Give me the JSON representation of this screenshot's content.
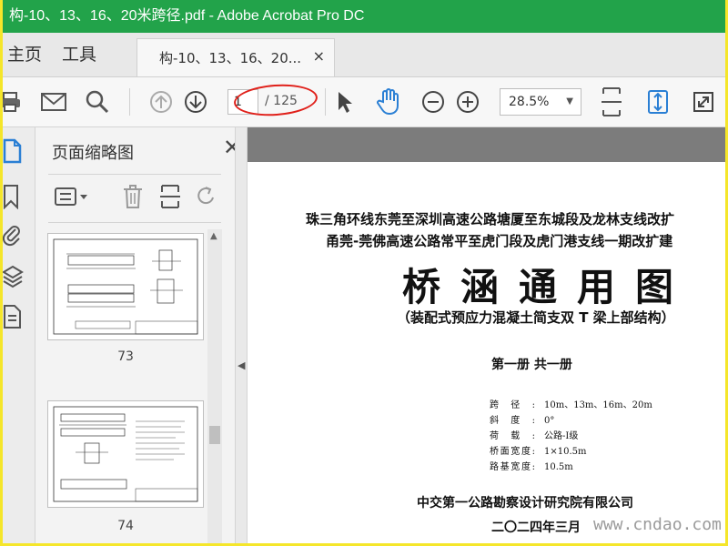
{
  "window": {
    "title": "构-10、13、16、20米跨径.pdf - Adobe Acrobat Pro DC",
    "titlebar_color": "#22a34a"
  },
  "nav": {
    "home": "主页",
    "tools": "工具"
  },
  "tab": {
    "label": "构-10、13、16、20...",
    "close": "×"
  },
  "toolbar": {
    "current_page": "1",
    "total_pages": "/ 125",
    "zoom": "28.5%",
    "zoom_caret": "▼",
    "icons": [
      "print-icon",
      "mail-icon",
      "search-icon",
      "prev-page-icon",
      "next-page-icon",
      "select-cursor-icon",
      "hand-icon",
      "zoom-out-icon",
      "zoom-in-icon",
      "fit-width-icon",
      "fit-page-icon",
      "full-screen-icon"
    ]
  },
  "panel": {
    "title": "页面缩略图",
    "close": "✕",
    "thumbnails": [
      {
        "label": "73"
      },
      {
        "label": "74"
      }
    ]
  },
  "document": {
    "line1": "珠三角环线东莞至深圳高速公路塘厦至东城段及龙林支线改扩",
    "line2": "甬莞-莞佛高速公路常平至虎门段及虎门港支线一期改扩建",
    "title": "桥涵通用图",
    "subtitle": "（装配式预应力混凝土简支双 T 梁上部结构）",
    "volume": "第一册   共一册",
    "specs": [
      {
        "key": "跨径:",
        "value": "10m、13m、16m、20m"
      },
      {
        "key": "斜度:",
        "value": "0°"
      },
      {
        "key": "荷载:",
        "value": "公路-Ⅰ级"
      },
      {
        "key": "桥面宽度:",
        "value": "1×10.5m"
      },
      {
        "key": "路基宽度:",
        "value": "10.5m"
      }
    ],
    "org": "中交第一公路勘察设计研究院有限公司",
    "date": "二〇二四年三月"
  },
  "watermark": "www.cndao.com",
  "colors": {
    "accent": "#2a7fd4",
    "annotation": "#e0201a",
    "frame": "#f5e62a"
  }
}
